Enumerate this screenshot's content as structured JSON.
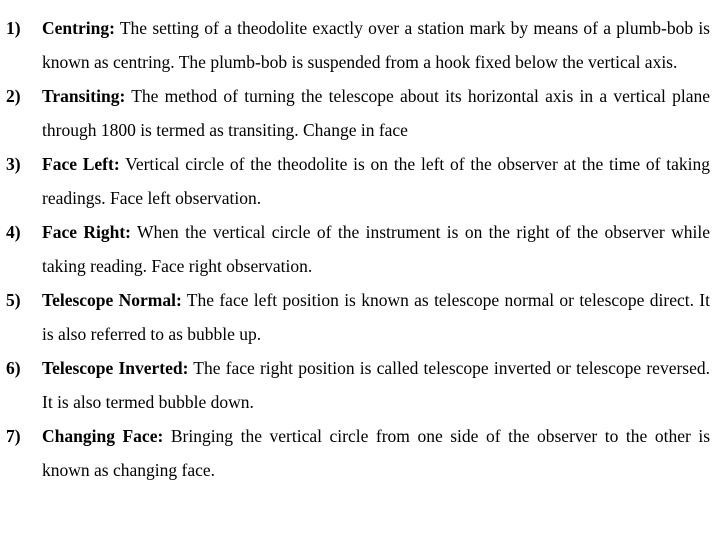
{
  "document": {
    "items": [
      {
        "number": "1)",
        "term": "Centring:",
        "text": " The setting of a theodolite exactly over a station mark by means of a plumb-bob is known as centring. The plumb-bob is suspended from a hook fixed below the vertical axis."
      },
      {
        "number": "2)",
        "term": "Transiting:",
        "text": " The method of turning the telescope about its horizontal axis in a vertical plane through 1800 is termed as transiting. Change in face"
      },
      {
        "number": "3)",
        "term": "Face Left:",
        "text": " Vertical circle of the theodolite is on the left of the observer at the time of taking readings. Face left observation."
      },
      {
        "number": "4)",
        "term": "Face Right:",
        "text": " When the vertical circle of the instrument is on the right of the observer while taking reading. Face right observation."
      },
      {
        "number": "5)",
        "term": "Telescope Normal:",
        "text": " The face left position is known as telescope normal or telescope direct. It is also referred to as bubble up."
      },
      {
        "number": "6)",
        "term": "Telescope Inverted:",
        "text": " The face right position is called telescope inverted or telescope reversed. It is also termed bubble down."
      },
      {
        "number": "7)",
        "term": "Changing Face:",
        "text": " Bringing the vertical circle from one side of the observer to the other is known as changing face."
      }
    ]
  }
}
